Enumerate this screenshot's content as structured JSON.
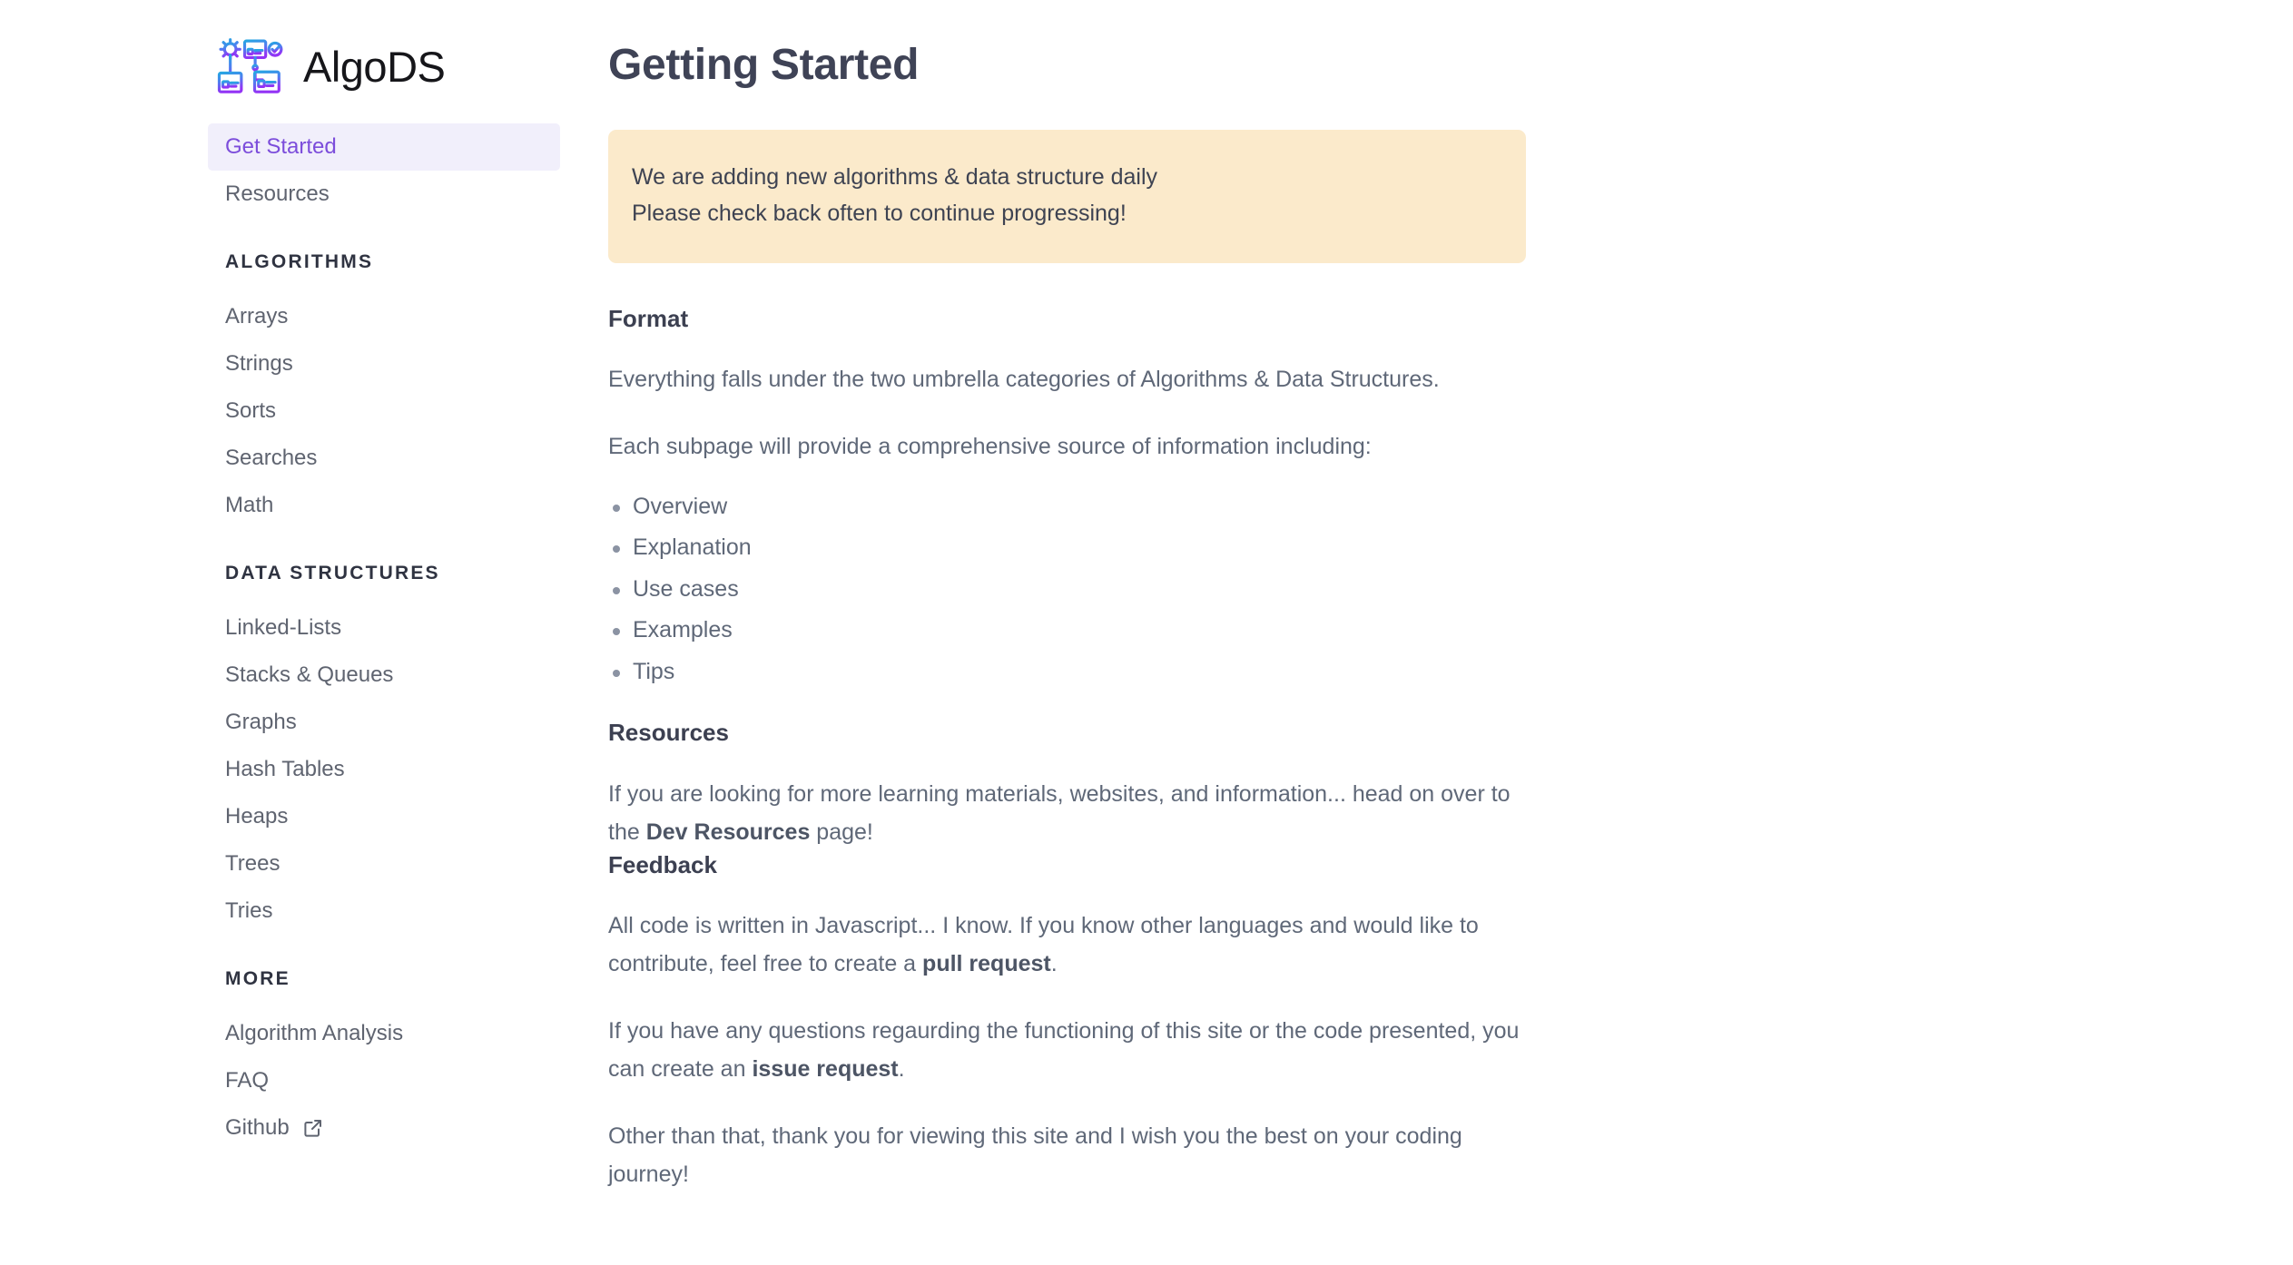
{
  "brand": {
    "name": "AlgoDS",
    "logo_icon": "algods-flowchart-logo",
    "logo_colors": {
      "top": "#2aa9e0",
      "bottom": "#8b3dfc"
    }
  },
  "sidebar": {
    "top_items": [
      {
        "label": "Get Started",
        "active": true
      },
      {
        "label": "Resources",
        "active": false
      }
    ],
    "sections": [
      {
        "title": "ALGORITHMS",
        "items": [
          {
            "label": "Arrays"
          },
          {
            "label": "Strings"
          },
          {
            "label": "Sorts"
          },
          {
            "label": "Searches"
          },
          {
            "label": "Math"
          }
        ]
      },
      {
        "title": "DATA STRUCTURES",
        "items": [
          {
            "label": "Linked-Lists"
          },
          {
            "label": "Stacks & Queues"
          },
          {
            "label": "Graphs"
          },
          {
            "label": "Hash Tables"
          },
          {
            "label": "Heaps"
          },
          {
            "label": "Trees"
          },
          {
            "label": "Tries"
          }
        ]
      },
      {
        "title": "MORE",
        "items": [
          {
            "label": "Algorithm Analysis"
          },
          {
            "label": "FAQ"
          },
          {
            "label": "Github",
            "external_icon": "external-link-icon"
          }
        ]
      }
    ],
    "active_item_bg": "#f1effb",
    "active_item_color": "#7c4ddb"
  },
  "main": {
    "title": "Getting Started",
    "alert": {
      "bg": "#fbeacb",
      "line1": "We are adding new algorithms & data structure daily",
      "line2": "Please check back often to continue progressing!"
    },
    "format": {
      "heading": "Format",
      "para1": "Everything falls under the two umbrella categories of Algorithms & Data Structures.",
      "para2": "Each subpage will provide a comprehensive source of information including:",
      "bullets": [
        "Overview",
        "Explanation",
        "Use cases",
        "Examples",
        "Tips"
      ]
    },
    "resources": {
      "heading": "Resources",
      "para_pre": "If you are looking for more learning materials, websites, and information... head on over to the ",
      "para_bold": "Dev Resources",
      "para_post": " page!"
    },
    "feedback": {
      "heading": "Feedback",
      "para1_pre": "All code is written in Javascript... I know. If you know other languages and would like to contribute, feel free to create a ",
      "para1_bold": "pull request",
      "para1_post": ".",
      "para2_pre": "If you have any questions regaurding the functioning of this site or the code presented, you can create an ",
      "para2_bold": "issue request",
      "para2_post": ".",
      "para3": "Other than that, thank you for viewing this site and I wish you the best on your coding journey!"
    }
  }
}
